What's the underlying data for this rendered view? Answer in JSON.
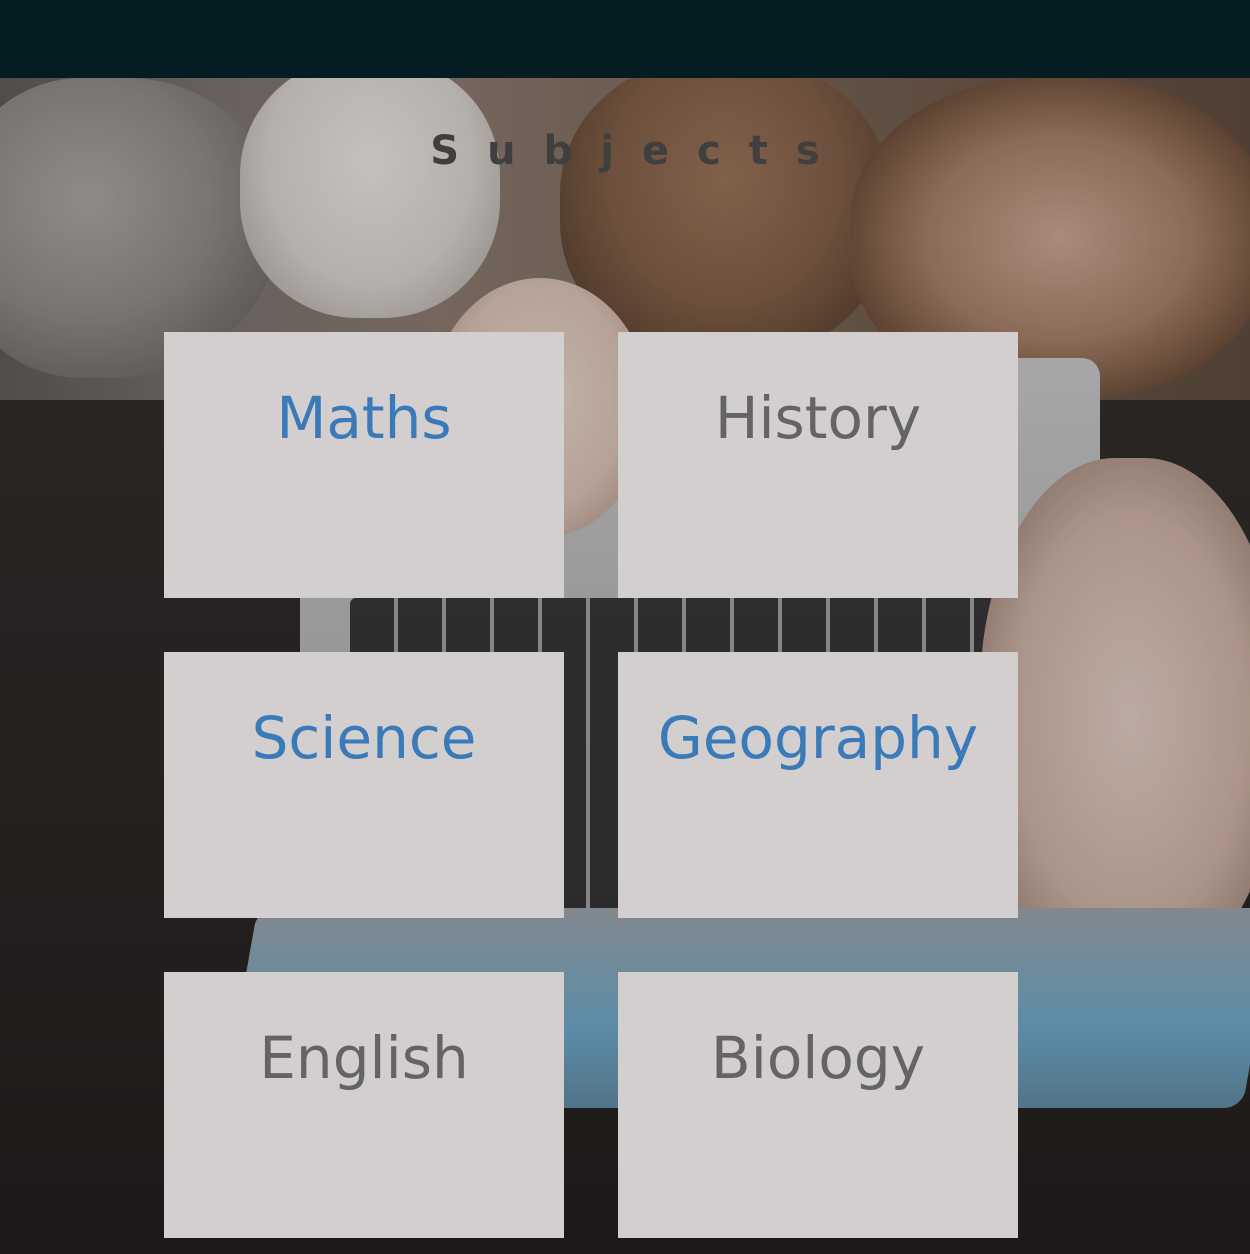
{
  "header": {
    "title": "Subjects"
  },
  "subjects": [
    {
      "label": "Maths",
      "style": "link",
      "color": "#3a7ab8"
    },
    {
      "label": "History",
      "style": "plain",
      "color": "#646464"
    },
    {
      "label": "Science",
      "style": "link",
      "color": "#3a7ab8"
    },
    {
      "label": "Geography",
      "style": "link",
      "color": "#3a7ab8"
    },
    {
      "label": "English",
      "style": "plain",
      "color": "#646464"
    },
    {
      "label": "Biology",
      "style": "plain",
      "color": "#646464"
    }
  ],
  "colors": {
    "top_bar": "#051c22",
    "card_background": "#d3cfcf",
    "title_text": "#3f3f3f"
  }
}
